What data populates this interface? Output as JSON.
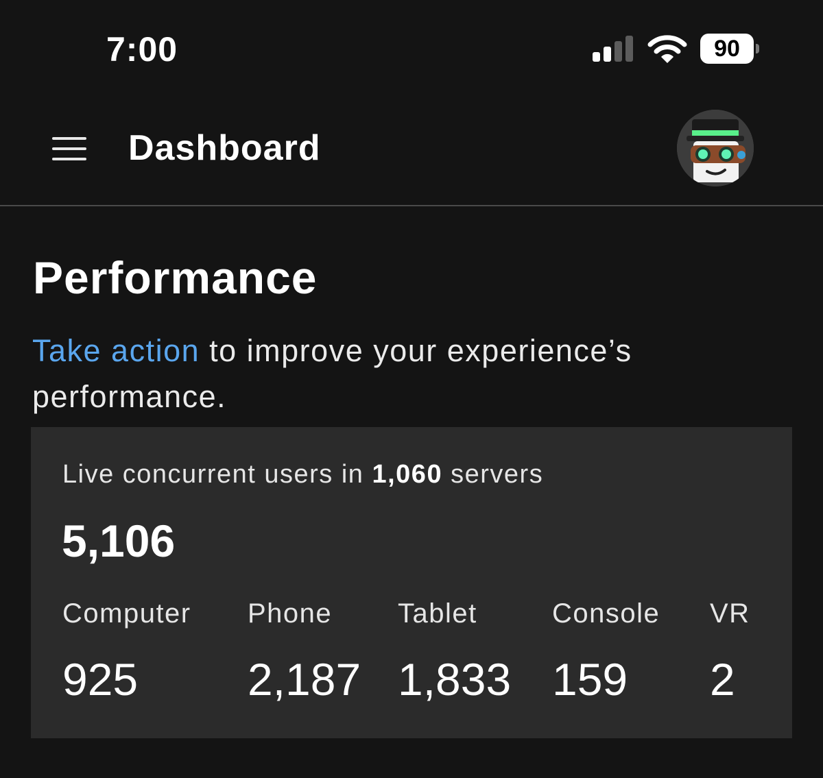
{
  "status_bar": {
    "time": "7:00",
    "battery_level": "90",
    "signal_bars_active": 2,
    "signal_bars_total": 4
  },
  "header": {
    "title": "Dashboard",
    "menu_icon": "hamburger-menu-icon",
    "avatar_icon": "user-avatar-icon"
  },
  "performance": {
    "title": "Performance",
    "link_text": "Take action",
    "description_rest": " to improve your experience’s performance.",
    "card": {
      "caption_prefix": "Live concurrent users in ",
      "server_count": "1,060",
      "caption_suffix": " servers",
      "total_users": "5,106",
      "devices": [
        {
          "label": "Computer",
          "value": "925"
        },
        {
          "label": "Phone",
          "value": "2,187"
        },
        {
          "label": "Tablet",
          "value": "1,833"
        },
        {
          "label": "Console",
          "value": "159"
        },
        {
          "label": "VR",
          "value": "2"
        }
      ]
    }
  },
  "colors": {
    "background": "#141414",
    "card": "#2b2b2b",
    "link": "#5aa6ee",
    "divider": "#4a4a4a",
    "text": "#ffffff"
  }
}
